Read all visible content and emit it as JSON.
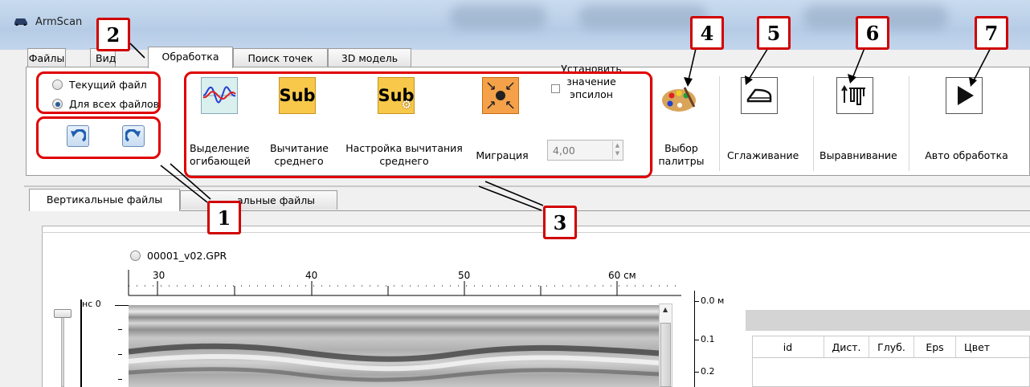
{
  "window": {
    "title": "ArmScan"
  },
  "tabs": [
    "Файлы",
    "Вид",
    "Обработка",
    "Поиск точек",
    "3D модель"
  ],
  "ribbon": {
    "file_scope": {
      "current": "Текущий файл",
      "all": "Для всех файлов",
      "selected": "all"
    },
    "undo_icon": "undo-icon",
    "redo_icon": "redo-icon",
    "envelope": "Выделение огибающей",
    "sub_mean": {
      "icon_text": "Sub",
      "label": "Вычитание среднего"
    },
    "sub_settings": {
      "icon_text": "Sub",
      "label": "Настройка вычитания среднего"
    },
    "migration": "Миграция",
    "epsilon": {
      "checkbox_label": "Установить значение эпсилон",
      "value": "4,00"
    },
    "palette": "Выбор палитры",
    "smoothing": "Сглаживание",
    "alignment": "Выравнивание",
    "auto": "Авто обработка"
  },
  "callouts": [
    "1",
    "2",
    "3",
    "4",
    "5",
    "6",
    "7"
  ],
  "lower_tabs": [
    "Вертикальные файлы",
    "альные файлы"
  ],
  "file": {
    "name": "00001_v02.GPR"
  },
  "ruler": {
    "ticks": [
      "30",
      "40",
      "50",
      "60 см"
    ],
    "left_label": "нс 0",
    "right_ticks": [
      "0.0 м",
      "0.1",
      "0.2"
    ]
  },
  "table": {
    "headers": [
      "id",
      "Дист.",
      "Глуб.",
      "Eps",
      "Цвет"
    ]
  },
  "colors": {
    "accent_red": "#e00000",
    "ribbon_bg": "#ffffff"
  }
}
